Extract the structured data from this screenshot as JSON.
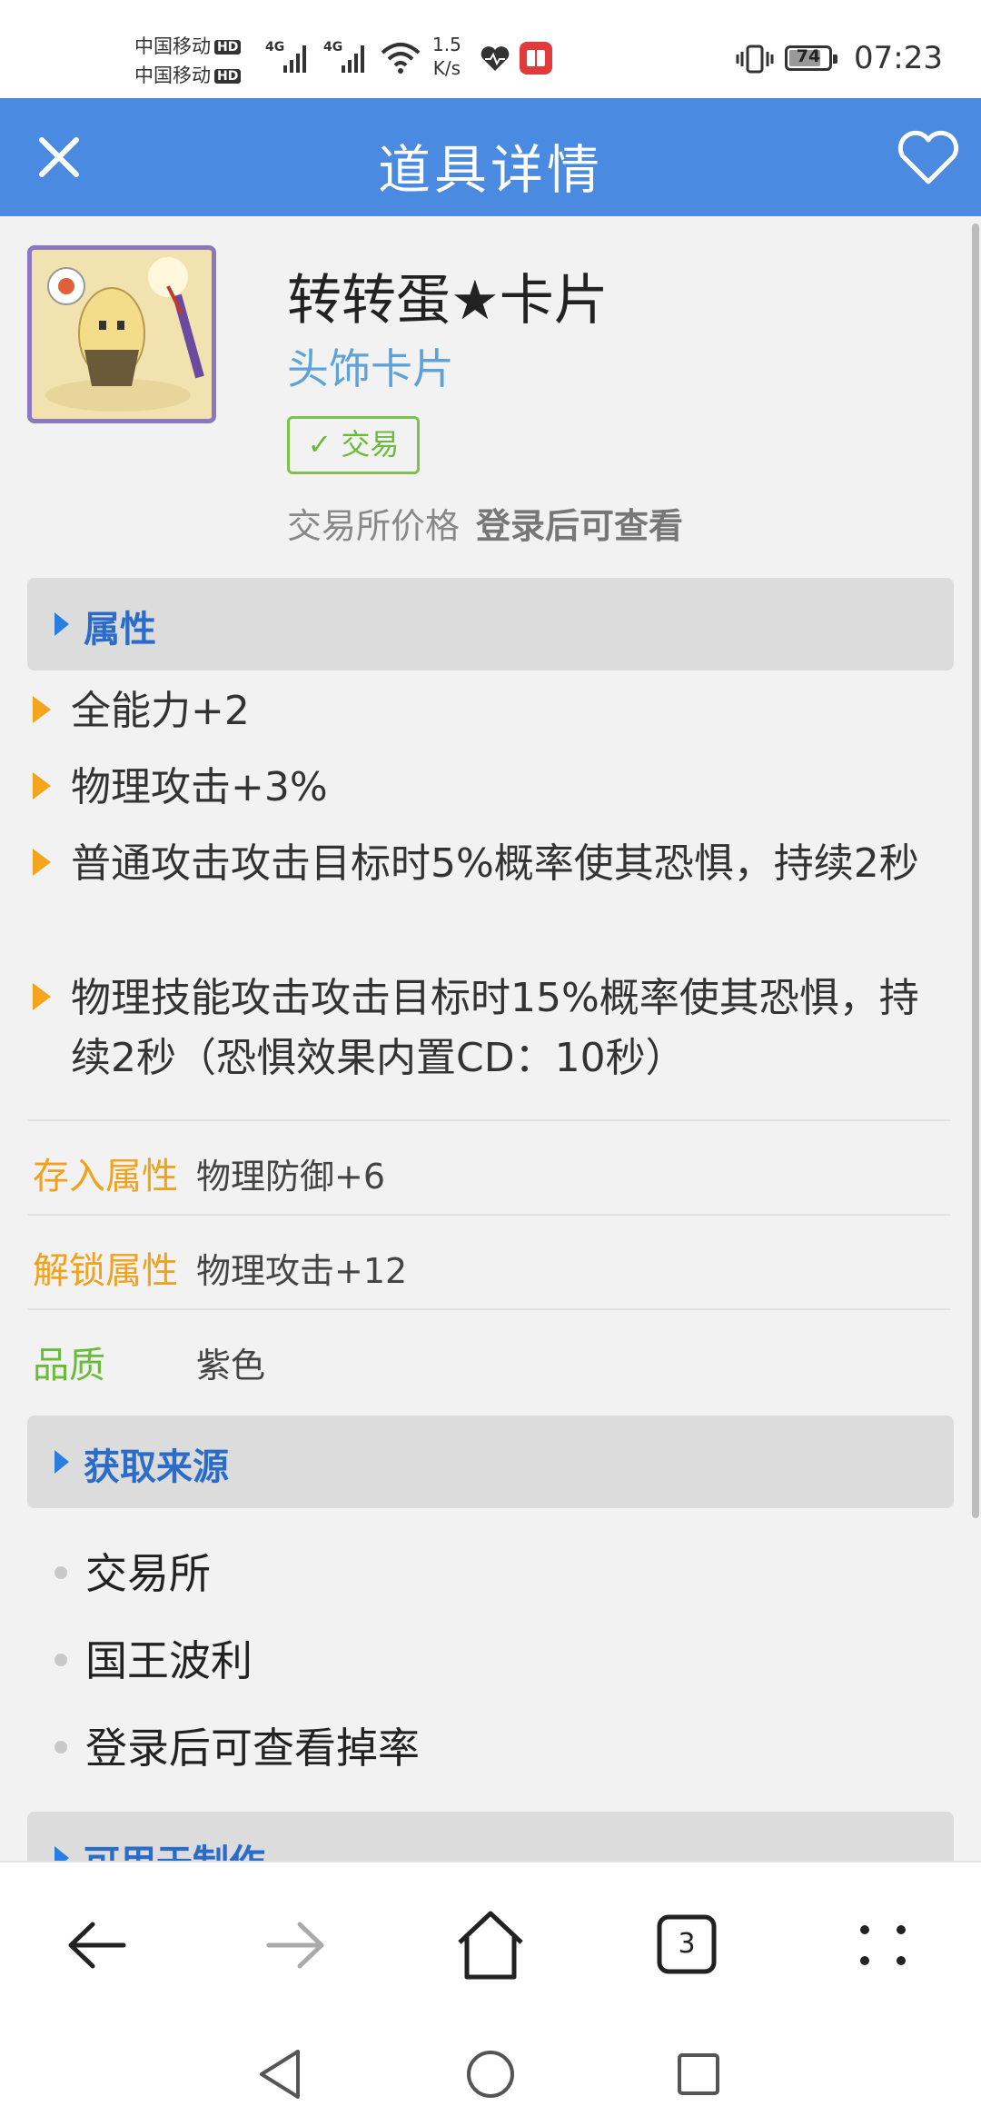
{
  "status_bar": {
    "carrier1": "中国移动",
    "carrier2": "中国移动",
    "hd": "HD",
    "network1": "4G",
    "network2": "4G",
    "net_speed_value": "1.5",
    "net_speed_unit": "K/s",
    "battery": "74",
    "time": "07:23"
  },
  "app_bar": {
    "title": "道具详情",
    "close_icon": "close-icon",
    "favorite_icon": "heart-outline-icon"
  },
  "item": {
    "name": "转转蛋★卡片",
    "type": "头饰卡片",
    "trade_badge": "✓ 交易",
    "price_label": "交易所价格",
    "price_value": "登录后可查看"
  },
  "attributes": {
    "header": "属性",
    "list": [
      "全能力+2",
      "物理攻击+3%",
      "普通攻击攻击目标时5%概率使其恐惧，持续2秒",
      "物理技能攻击攻击目标时15%概率使其恐惧，持续2秒（恐惧效果内置CD：10秒）"
    ]
  },
  "props": {
    "deposit_label": "存入属性",
    "deposit_value": "物理防御+6",
    "unlock_label": "解锁属性",
    "unlock_value": "物理攻击+12",
    "quality_label": "品质",
    "quality_value": "紫色"
  },
  "sources": {
    "header": "获取来源",
    "list": [
      "交易所",
      "国王波利",
      "登录后可查看掉率"
    ]
  },
  "crafting": {
    "header": "可用于制作"
  },
  "bottom_nav": {
    "tab_count": "3"
  },
  "colors": {
    "app_bar": "#4a8ae0",
    "section_title": "#2a6cc8",
    "attr_bullet": "#f4a51c",
    "key_orange": "#f0a21c",
    "key_green": "#6cba3c",
    "item_type": "#5da3d8"
  }
}
